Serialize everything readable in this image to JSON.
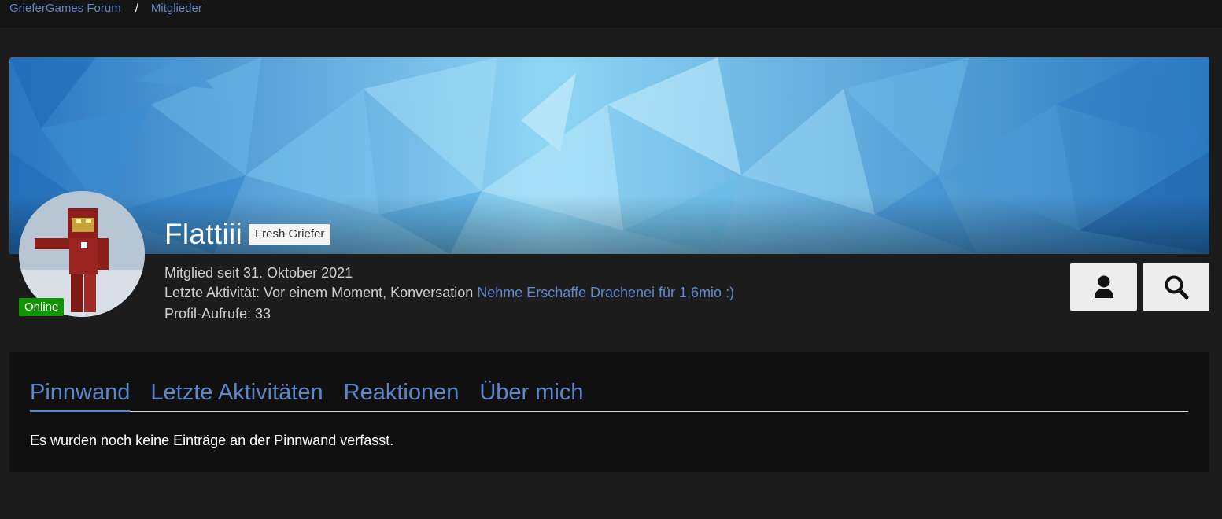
{
  "breadcrumb": {
    "home": "GrieferGames Forum",
    "separator": "/",
    "current": "Mitglieder"
  },
  "profile": {
    "username": "Flattiii",
    "rank": "Fresh Griefer",
    "status": "Online",
    "member_since": "Mitglied seit 31. Oktober 2021",
    "last_activity_prefix": "Letzte Aktivität: Vor einem Moment,",
    "last_activity_kind": "Konversation",
    "last_activity_link": "Nehme Erschaffe Drachenei für 1,6mio :)",
    "profile_views": "Profil-Aufrufe: 33"
  },
  "actions": {
    "profile_icon": "user-icon",
    "search_icon": "search-icon"
  },
  "tabs": [
    {
      "label": "Pinnwand",
      "active": true
    },
    {
      "label": "Letzte Aktivitäten",
      "active": false
    },
    {
      "label": "Reaktionen",
      "active": false
    },
    {
      "label": "Über mich",
      "active": false
    }
  ],
  "wall": {
    "empty_message": "Es wurden noch keine Einträge an der Pinnwand verfasst."
  },
  "colors": {
    "link": "#5a87c9",
    "online": "#109400",
    "background": "#1c1c1c",
    "panel": "#101010"
  }
}
